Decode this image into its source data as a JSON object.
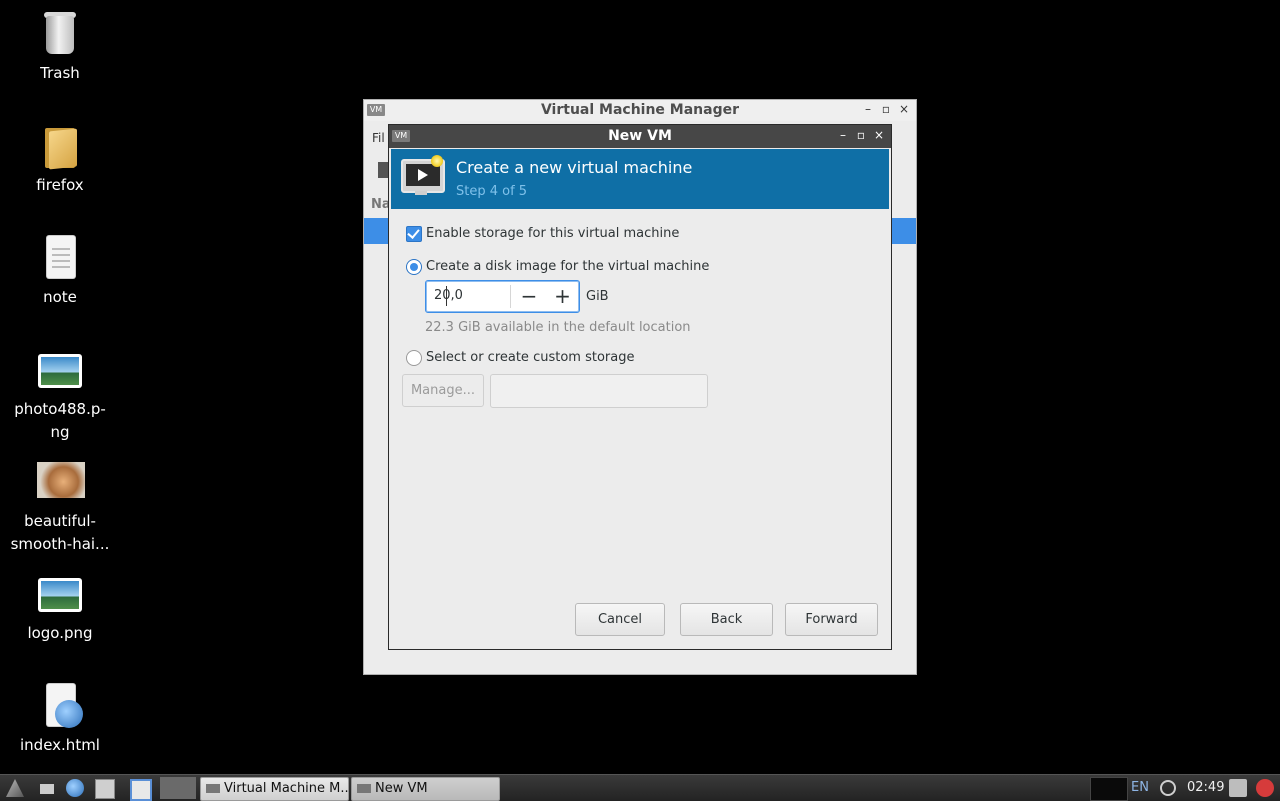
{
  "desktop": {
    "icons": [
      {
        "label": "Trash"
      },
      {
        "label": "firefox"
      },
      {
        "label": "note"
      },
      {
        "label_line1": "photo488.p-",
        "label_line2": "ng"
      },
      {
        "label_line1": "beautiful-",
        "label_line2": "smooth-hai..."
      },
      {
        "label": "logo.png"
      },
      {
        "label": "index.html"
      }
    ]
  },
  "main_window": {
    "title": "Virtual Machine Manager",
    "menu_fragment": "Fil",
    "column_fragment": "Na",
    "controls": {
      "minimize": "–",
      "maximize": "▫",
      "close": "×"
    }
  },
  "dialog": {
    "title": "New VM",
    "controls": {
      "minimize": "–",
      "maximize": "▫",
      "close": "×"
    },
    "header_title": "Create a new virtual machine",
    "header_step": "Step 4 of 5",
    "enable_storage_label": "Enable storage for this virtual machine",
    "enable_storage_checked": true,
    "create_disk_label": "Create a disk image for the virtual machine",
    "disk_size_value": "20,0",
    "disk_unit": "GiB",
    "available_hint": "22.3 GiB available in the default location",
    "custom_storage_label": "Select or create custom storage",
    "manage_label": "Manage...",
    "custom_storage_value": "",
    "buttons": {
      "cancel": "Cancel",
      "back": "Back",
      "forward": "Forward"
    },
    "spin_minus": "−",
    "spin_plus": "+"
  },
  "taskbar": {
    "tasks": [
      {
        "label": "Virtual Machine M..."
      },
      {
        "label": "New VM"
      }
    ],
    "language": "EN",
    "clock": "02:49"
  },
  "colors": {
    "accent": "#3d8ee7",
    "header": "#0f6fa6"
  }
}
